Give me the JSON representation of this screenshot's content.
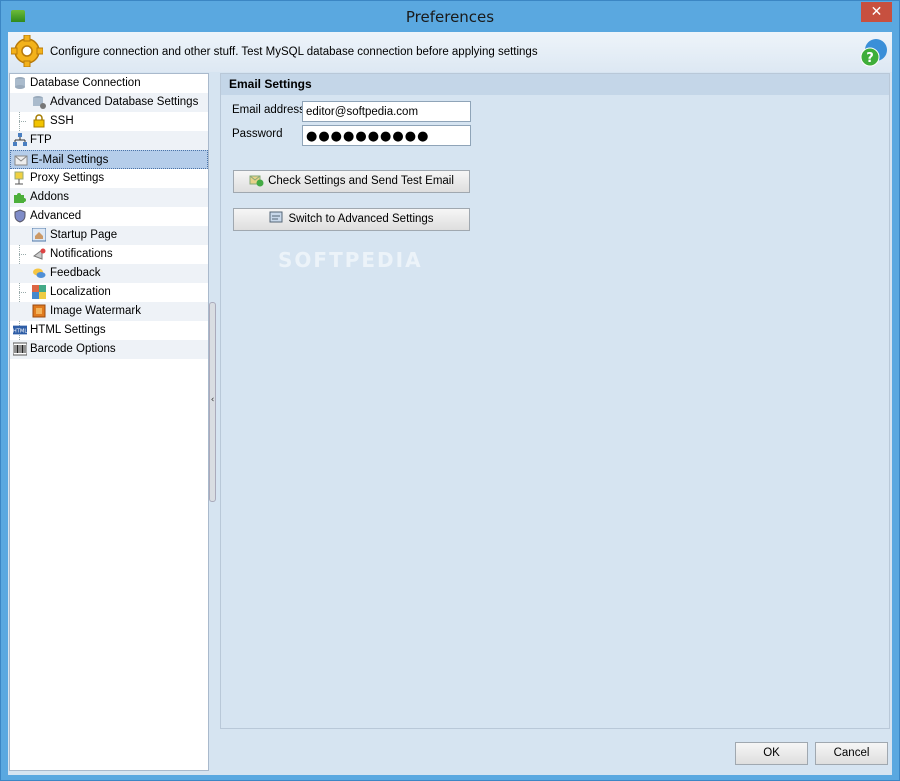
{
  "window": {
    "title": "Preferences",
    "close_glyph": "✕"
  },
  "header": {
    "text": "Configure connection and other stuff. Test MySQL database connection before applying settings",
    "icons": [
      "gear-icon",
      "help-icon"
    ]
  },
  "tree": {
    "items": [
      {
        "label": "Database Connection",
        "icon": "database-icon"
      },
      {
        "label": "Advanced Database Settings",
        "icon": "database-settings-icon"
      },
      {
        "label": "SSH",
        "icon": "lock-icon"
      },
      {
        "label": "FTP",
        "icon": "network-icon"
      },
      {
        "label": "E-Mail Settings",
        "icon": "envelope-icon"
      },
      {
        "label": "Proxy Settings",
        "icon": "proxy-icon"
      },
      {
        "label": "Addons",
        "icon": "puzzle-icon"
      },
      {
        "label": "Advanced",
        "icon": "shield-icon"
      },
      {
        "label": "Startup Page",
        "icon": "home-page-icon"
      },
      {
        "label": "Notifications",
        "icon": "notification-icon"
      },
      {
        "label": "Feedback",
        "icon": "feedback-icon"
      },
      {
        "label": "Localization",
        "icon": "localization-icon"
      },
      {
        "label": "Image Watermark",
        "icon": "image-icon"
      },
      {
        "label": "HTML Settings",
        "icon": "html-icon"
      },
      {
        "label": "Barcode Options",
        "icon": "barcode-icon"
      }
    ],
    "selected": "E-Mail Settings"
  },
  "panel": {
    "title": "Email Settings",
    "email_label": "Email address",
    "email_value": "editor@softpedia.com",
    "password_label": "Password",
    "password_mask": "●●●●●●●●●●",
    "check_button": "Check Settings and Send Test Email",
    "advanced_button": "Switch to Advanced Settings"
  },
  "watermark": "SOFTPEDIA",
  "footer": {
    "ok": "OK",
    "cancel": "Cancel"
  },
  "colors": {
    "selection": "#b5cdea",
    "panel_bg": "#d6e4f1",
    "frame": "#5aa8e0",
    "close": "#c7503f"
  }
}
